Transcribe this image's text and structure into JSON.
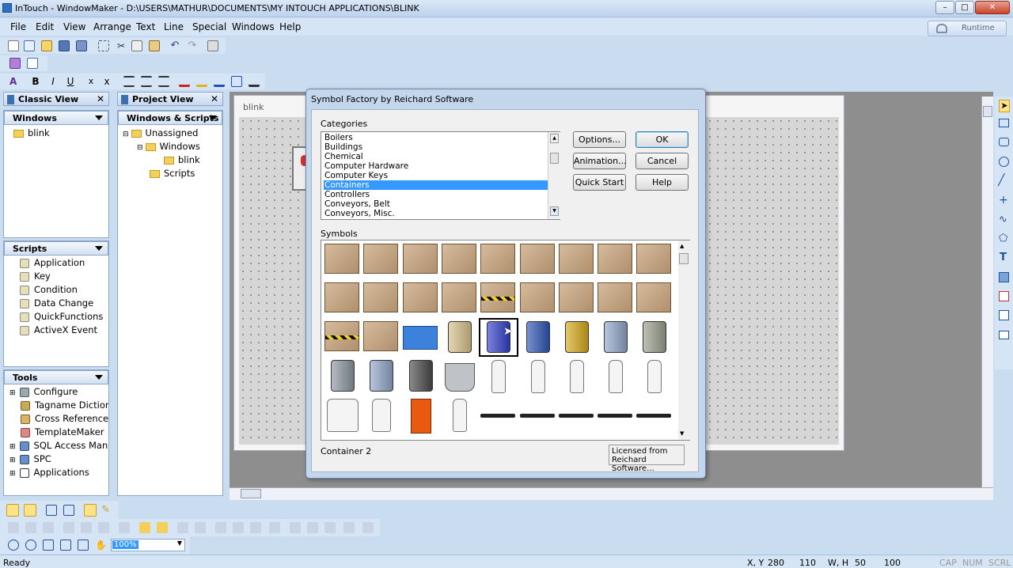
{
  "window": {
    "title": "InTouch - WindowMaker - D:\\USERS\\MATHUR\\DOCUMENTS\\MY INTOUCH APPLICATIONS\\BLINK",
    "minimize": "–",
    "maximize": "□",
    "close": "✕"
  },
  "menu": [
    "File",
    "Edit",
    "View",
    "Arrange",
    "Text",
    "Line",
    "Special",
    "Windows",
    "Help"
  ],
  "runtime_label": "Runtime",
  "classic_view": {
    "title": "Classic View",
    "close": "✕",
    "windows_header": "Windows",
    "windows_items": [
      "blink"
    ],
    "scripts_header": "Scripts",
    "scripts_items": [
      "Application",
      "Key",
      "Condition",
      "Data Change",
      "QuickFunctions",
      "ActiveX Event"
    ],
    "tools_header": "Tools",
    "tools_items": [
      "Configure",
      "Tagname Dictiona",
      "Cross Reference",
      "TemplateMaker",
      "SQL Access Mana",
      "SPC",
      "Applications"
    ]
  },
  "project_view": {
    "title": "Project View",
    "close": "✕",
    "header": "Windows & Scripts",
    "tree": [
      "Unassigned",
      "Windows",
      "blink",
      "Scripts"
    ]
  },
  "canvas": {
    "window_name": "blink"
  },
  "dialog": {
    "title": "Symbol Factory by Reichard Software",
    "categories_label": "Categories",
    "categories": [
      "Boilers",
      "Buildings",
      "Chemical",
      "Computer Hardware",
      "Computer Keys",
      "Containers",
      "Controllers",
      "Conveyors, Belt",
      "Conveyors, Misc."
    ],
    "selected_category": "Containers",
    "buttons": {
      "options": "Options...",
      "animation": "Animation...",
      "quick_start": "Quick Start",
      "ok": "OK",
      "cancel": "Cancel",
      "help": "Help"
    },
    "symbols_label": "Symbols",
    "selected_symbol": "Container 2",
    "license_button": "Licensed from Reichard Software...",
    "symbol_rows": [
      [
        "crate-wood",
        "crate-slats",
        "cardboard-box-taped",
        "cardboard-box-open-flaps",
        "cardboard-box",
        "cardboard-box-open-lid",
        "cardboard-box",
        "cardboard-box",
        "cardboard-box-taped"
      ],
      [
        "cardboard-box-flat",
        "cardboard-box",
        "cardboard-box-taped",
        "cardboard-box-label",
        "cardboard-box-hazard-tape",
        "cardboard-box-unfolded",
        "cardboard-box-front",
        "cardboard-box-front-taped",
        "cardboard-box-front-label"
      ],
      [
        "cardboard-box-hazard-front",
        "cardboard-box-cross",
        "blue-tote-bin",
        "tan-drum",
        "blue-drum-selected",
        "blue-drum",
        "yellow-drum",
        "steel-drum-blue",
        "gray-drum"
      ],
      [
        "gray-drum-dark",
        "gray-drum-banded",
        "black-drum",
        "steel-bucket",
        "white-jug",
        "glass-bottle",
        "dropper-bottle",
        "white-bottle",
        "white-bottle-tall"
      ],
      [
        "white-tub",
        "white-jar",
        "orange-canister",
        "spray-bottle",
        "pallet-flat",
        "pallet-thin",
        "pallet-gray",
        "pallet-slats",
        "pallet-dark"
      ]
    ]
  },
  "zoom": "100%",
  "status": {
    "ready": "Ready",
    "xy_label": "X, Y",
    "x": "280",
    "y": "110",
    "wh_label": "W, H",
    "w": "50",
    "h": "100",
    "cap": "CAP",
    "num": "NUM",
    "scrl": "SCRL"
  }
}
